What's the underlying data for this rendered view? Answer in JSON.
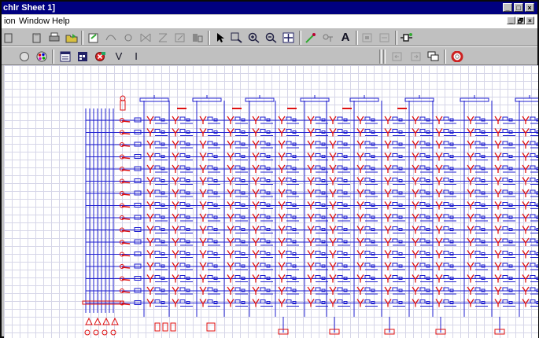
{
  "window": {
    "title": "chlr Sheet 1]",
    "caption_buttons": [
      "_",
      "□",
      "×"
    ],
    "mdi_buttons": [
      "_",
      "🗗",
      "×"
    ]
  },
  "menubar": {
    "items": [
      "ion",
      "Window",
      "Help"
    ]
  },
  "toolbar1": {
    "icons": [
      "copy-icon",
      "paste-icon",
      "print-icon",
      "open-folder-icon",
      "new-sheet-icon",
      "wire-icon",
      "bus-icon",
      "mirror-icon",
      "rotate-icon",
      "resize-icon",
      "component-icon",
      "pointer-icon",
      "zoom-area-icon",
      "zoom-in-icon",
      "zoom-out-icon",
      "zoom-fit-icon",
      "probe-icon",
      "netname-icon",
      "text-icon",
      "grid-icon",
      "layers-icon",
      "connector-icon"
    ],
    "text_tool": "A"
  },
  "toolbar2": {
    "icons": [
      "circle-icon",
      "palette-icon",
      "list-icon",
      "calendar-icon",
      "delete-icon",
      "undo-icon",
      "back-icon",
      "forward-icon",
      "cascade-icon",
      "help-icon"
    ],
    "v_label": "V",
    "i_label": "I"
  },
  "colors": {
    "titlebar": "#000080",
    "schematic_blue": "#1f1fd0",
    "schematic_red": "#e01010"
  }
}
